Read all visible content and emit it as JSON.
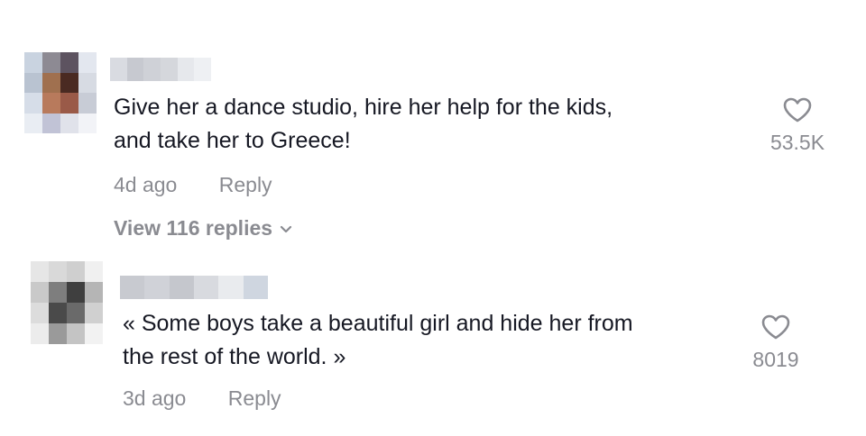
{
  "comments": [
    {
      "text_lines": [
        "Give her a dance studio, hire her help for the kids,",
        "and take her to Greece!"
      ],
      "time": "4d ago",
      "reply_label": "Reply",
      "likes": "53.5K",
      "view_replies": "View 116 replies",
      "avatar_colors": [
        "#c9d3e0",
        "#8d8a93",
        "#5d5360",
        "#e3e7ef",
        "#b9c3d1",
        "#a0704f",
        "#4a2a22",
        "#d7dbe3",
        "#d6dde8",
        "#b87a5c",
        "#9a5a48",
        "#c8ccd6",
        "#e9edf3",
        "#c1c3d6",
        "#e0e2ea",
        "#f2f3f7"
      ],
      "username_blur_colors": [
        "#d9dbe1",
        "#c7c9d0",
        "#cfd1d7",
        "#d5d7dc",
        "#e6e8ec",
        "#eef0f3"
      ]
    },
    {
      "text_lines": [
        "« Some boys take a beautiful girl and hide her from",
        "the rest of the world. »"
      ],
      "time": "3d ago",
      "reply_label": "Reply",
      "likes": "8019",
      "avatar_colors": [
        "#e6e6e6",
        "#d9d9d9",
        "#cfcfcf",
        "#f0f0f0",
        "#c9c9c9",
        "#7e7e7e",
        "#3f3f3f",
        "#b5b5b5",
        "#dcdcdc",
        "#4a4a4a",
        "#6a6a6a",
        "#d0d0d0",
        "#ececec",
        "#9a9a9a",
        "#c4c4c4",
        "#f2f2f2"
      ],
      "username_blur_colors": [
        "#c8cad0",
        "#d0d2d8",
        "#c5c7cd",
        "#d8dadf",
        "#e9ebee",
        "#cfd6e0"
      ]
    }
  ],
  "icons": {
    "like": "heart-outline-icon",
    "expand": "chevron-down-icon"
  },
  "colors": {
    "text": "#161823",
    "secondary": "#8a8b91"
  }
}
